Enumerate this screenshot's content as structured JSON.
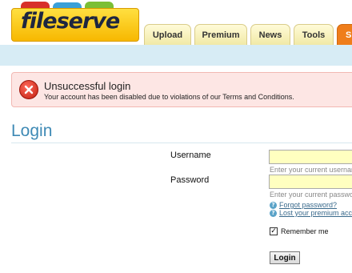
{
  "logo": {
    "text": "fileserve"
  },
  "nav": {
    "tabs": [
      {
        "label": "Upload"
      },
      {
        "label": "Premium"
      },
      {
        "label": "News"
      },
      {
        "label": "Tools"
      },
      {
        "label": "S"
      }
    ]
  },
  "error": {
    "title": "Unsuccessful login",
    "message": "Your account has been disabled due to violations of our Terms and Conditions."
  },
  "login": {
    "title": "Login",
    "username_label": "Username",
    "username_value": "",
    "username_hint": "Enter your current usernam",
    "password_label": "Password",
    "password_value": "",
    "password_hint": "Enter your current passwor",
    "forgot_password": "Forgot password?",
    "lost_premium": "Lost your premium accoun",
    "remember_me": "Remember me",
    "remember_checked": true,
    "button_label": "Login"
  },
  "colors": {
    "header_bar": "#d7ecf5",
    "nav_tab": "#fff6c4",
    "nav_active": "#ef7d1a",
    "title": "#3f8ab5",
    "error_bg": "#fde6e4",
    "input_bg": "#ffffc0"
  }
}
